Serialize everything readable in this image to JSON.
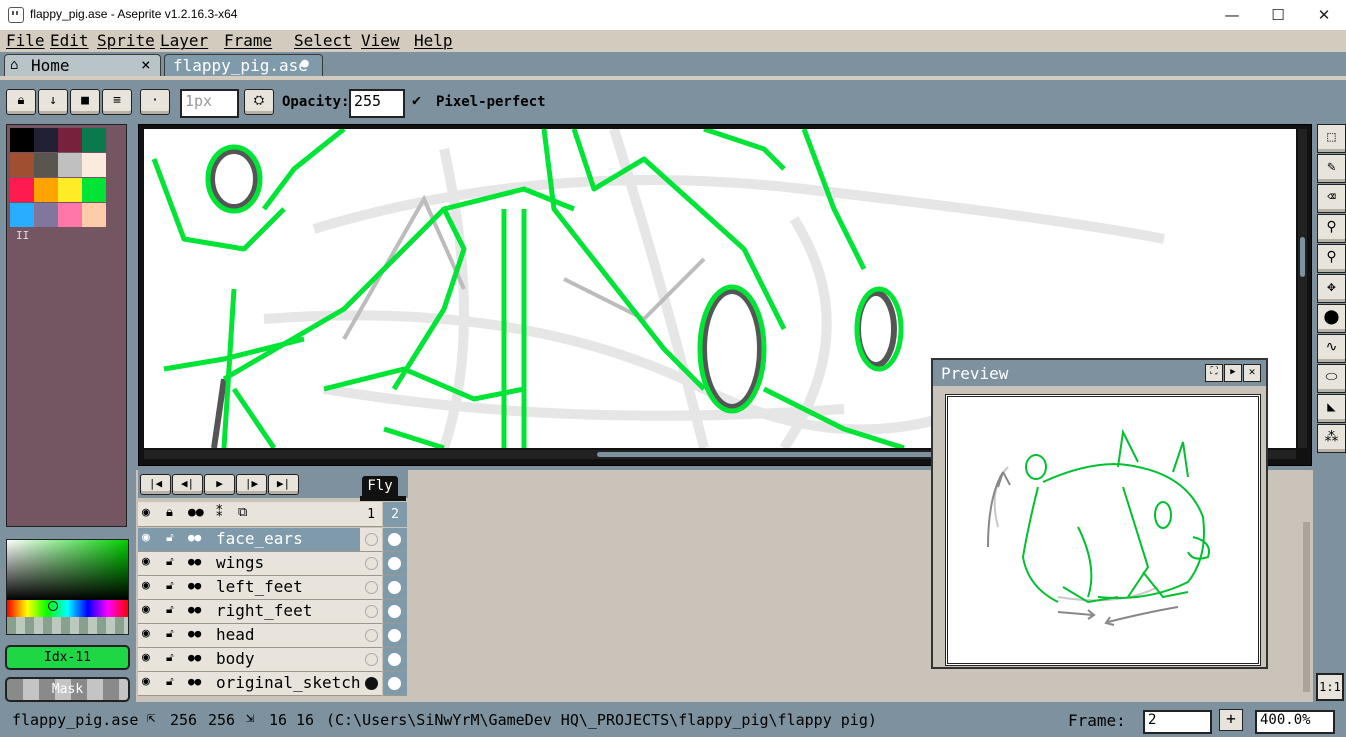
{
  "window": {
    "title": "flappy_pig.ase - Aseprite v1.2.16.3-x64",
    "minimize": "—",
    "maximize": "☐",
    "close": "✕"
  },
  "menu": [
    "File",
    "Edit",
    "Sprite",
    "Layer",
    "Frame",
    "Select",
    "View",
    "Help"
  ],
  "tabs": {
    "home_label": "Home",
    "home_close": "×",
    "file_label": "flappy_pig.ase",
    "file_modified": "●"
  },
  "context": {
    "brush_size_placeholder": "1px",
    "opacity_label": "Opacity:",
    "opacity_value": "255",
    "pixel_perfect_label": "Pixel-perfect",
    "pixel_perfect_checked": true
  },
  "palette": {
    "colors": [
      "#000000",
      "#222034",
      "#76223d",
      "#0a7a4d",
      "#a05030",
      "#595652",
      "#c0c0c0",
      "#fbeade",
      "#ff1a4f",
      "#ffa300",
      "#ffec27",
      "#00e436",
      "#29adff",
      "#83769c",
      "#ff77a8",
      "#ffccaa"
    ],
    "pager": "II"
  },
  "color_bar": {
    "fg_label": "Idx-11",
    "fg_color": "#1fd645",
    "bg_label": "Mask"
  },
  "timeline": {
    "tag_label": "Fly",
    "frame_headers": [
      "1",
      "2"
    ],
    "layers": [
      {
        "name": "face_ears",
        "selected": true,
        "cel1": "empty",
        "cel2": "filled"
      },
      {
        "name": "wings",
        "selected": false,
        "cel1": "empty",
        "cel2": "filled"
      },
      {
        "name": "left_feet",
        "selected": false,
        "cel1": "empty",
        "cel2": "filled"
      },
      {
        "name": "right_feet",
        "selected": false,
        "cel1": "empty",
        "cel2": "filled"
      },
      {
        "name": "head",
        "selected": false,
        "cel1": "empty",
        "cel2": "filled"
      },
      {
        "name": "body",
        "selected": false,
        "cel1": "empty",
        "cel2": "filled"
      },
      {
        "name": "original_sketch",
        "selected": false,
        "cel1": "filled",
        "cel2": "filled"
      }
    ]
  },
  "preview": {
    "title": "Preview"
  },
  "zoom_button": "1:1",
  "status": {
    "filename": "flappy_pig.ase",
    "size_w": "256",
    "size_h": "256",
    "grid_w": "16",
    "grid_h": "16",
    "path": "(C:\\Users\\SiNwYrM\\GameDev HQ\\_PROJECTS\\flappy_pig\\flappy pig)",
    "frame_label": "Frame:",
    "frame_value": "2",
    "add_frame": "+",
    "zoom_value": "400.0%"
  },
  "colors": {
    "accent_green": "#00e436",
    "selected_row": "#7f9aaa",
    "panel_bg": "#7d929e",
    "menu_bg": "#d2cbbe"
  }
}
